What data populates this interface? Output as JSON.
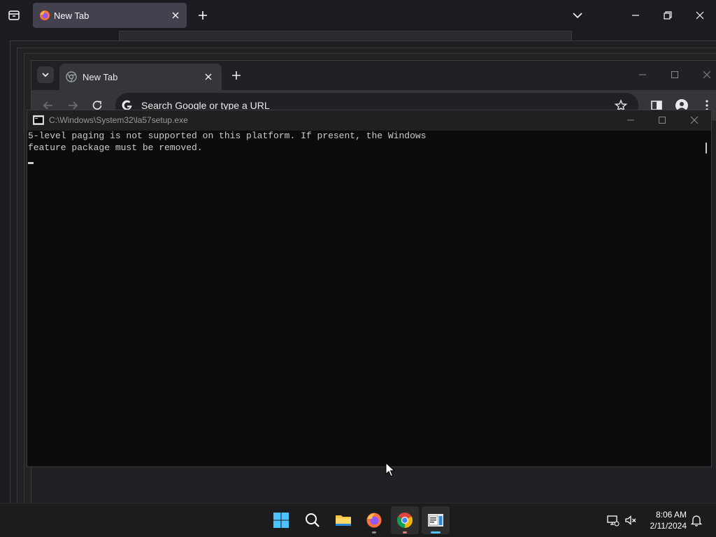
{
  "firefox": {
    "tab_title": "New Tab"
  },
  "chrome": {
    "tab_title": "New Tab",
    "omnibox_placeholder": "Search Google or type a URL"
  },
  "console": {
    "title": "C:\\Windows\\System32\\la57setup.exe",
    "lines": [
      "5-level paging is not supported on this platform. If present, the Windows",
      "feature package must be removed."
    ]
  },
  "taskbar": {
    "time": "8:06 AM",
    "date": "2/11/2024",
    "apps": [
      "windows-start",
      "search",
      "file-explorer",
      "firefox",
      "chrome",
      "console-host"
    ]
  },
  "colors": {
    "accent": "#4cc2ff",
    "console_bg": "#0c0c0c",
    "console_text": "#cccccc"
  }
}
